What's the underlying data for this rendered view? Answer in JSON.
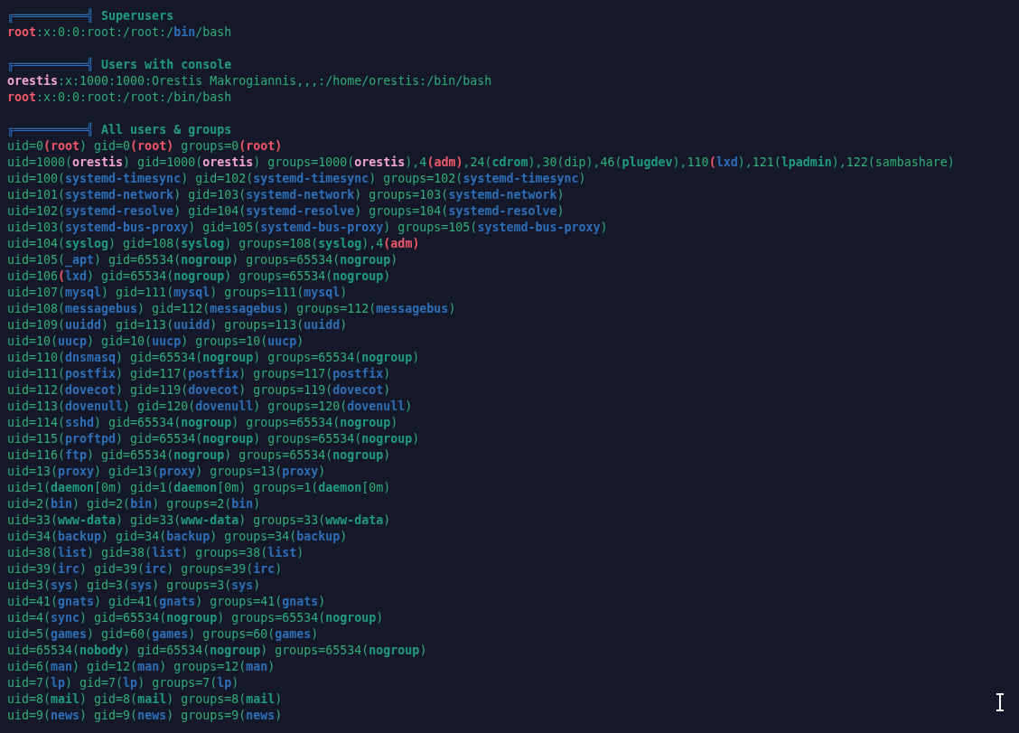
{
  "sections": [
    {
      "rule": "╔══════════╣",
      "title": "Superusers",
      "lines": [
        {
          "segments": [
            {
              "kind": "alert",
              "text": "root"
            },
            {
              "kind": "plain",
              "text": ":x:0:0:root:/root:/"
            },
            {
              "kind": "service",
              "text": "bin"
            },
            {
              "kind": "plain",
              "text": "/bash"
            }
          ]
        }
      ]
    },
    {
      "rule": "╔══════════╣",
      "title": "Users with console",
      "lines": [
        {
          "segments": [
            {
              "kind": "user",
              "text": "orestis"
            },
            {
              "kind": "plain",
              "text": ":x:1000:1000:Orestis Makrogiannis,,,:/home/orestis:/bin/bash"
            }
          ]
        },
        {
          "segments": [
            {
              "kind": "alert",
              "text": "root"
            },
            {
              "kind": "plain",
              "text": ":x:0:0:root:/root:/bin/bash"
            }
          ]
        }
      ]
    },
    {
      "rule": "╔══════════╣",
      "title": "All users & groups",
      "lines": [
        {
          "segments": [
            {
              "kind": "plain",
              "text": "uid=0"
            },
            {
              "kind": "alert",
              "text": "(root"
            },
            {
              "kind": "plain",
              "text": ") gid=0"
            },
            {
              "kind": "alert",
              "text": "(root)"
            },
            {
              "kind": "plain",
              "text": " groups=0"
            },
            {
              "kind": "alert",
              "text": "(root)"
            }
          ]
        },
        {
          "segments": [
            {
              "kind": "plain",
              "text": "uid=1000("
            },
            {
              "kind": "user",
              "text": "orestis"
            },
            {
              "kind": "plain",
              "text": ") gid=1000("
            },
            {
              "kind": "user",
              "text": "orestis"
            },
            {
              "kind": "plain",
              "text": ") groups=1000("
            },
            {
              "kind": "user",
              "text": "orestis"
            },
            {
              "kind": "plain",
              "text": "),4"
            },
            {
              "kind": "alert",
              "text": "(adm)"
            },
            {
              "kind": "plain",
              "text": ",24("
            },
            {
              "kind": "group",
              "text": "cdrom"
            },
            {
              "kind": "plain",
              "text": "),30(dip),46("
            },
            {
              "kind": "group",
              "text": "plugdev"
            },
            {
              "kind": "plain",
              "text": "),110"
            },
            {
              "kind": "alert",
              "text": "("
            },
            {
              "kind": "service",
              "text": "lxd"
            },
            {
              "kind": "plain",
              "text": "),121("
            },
            {
              "kind": "group",
              "text": "lpadmin"
            },
            {
              "kind": "plain",
              "text": "),122(sambashare)"
            }
          ]
        },
        {
          "segments": [
            {
              "kind": "plain",
              "text": "uid=100("
            },
            {
              "kind": "service",
              "text": "systemd-timesync"
            },
            {
              "kind": "plain",
              "text": ") gid=102("
            },
            {
              "kind": "service",
              "text": "systemd-timesync"
            },
            {
              "kind": "plain",
              "text": ") groups=102("
            },
            {
              "kind": "service",
              "text": "systemd-timesync"
            },
            {
              "kind": "plain",
              "text": ")"
            }
          ]
        },
        {
          "segments": [
            {
              "kind": "plain",
              "text": "uid=101("
            },
            {
              "kind": "service",
              "text": "systemd-network"
            },
            {
              "kind": "plain",
              "text": ") gid=103("
            },
            {
              "kind": "service",
              "text": "systemd-network"
            },
            {
              "kind": "plain",
              "text": ") groups=103("
            },
            {
              "kind": "service",
              "text": "systemd-network"
            },
            {
              "kind": "plain",
              "text": ")"
            }
          ]
        },
        {
          "segments": [
            {
              "kind": "plain",
              "text": "uid=102("
            },
            {
              "kind": "service",
              "text": "systemd-resolve"
            },
            {
              "kind": "plain",
              "text": ") gid=104("
            },
            {
              "kind": "service",
              "text": "systemd-resolve"
            },
            {
              "kind": "plain",
              "text": ") groups=104("
            },
            {
              "kind": "service",
              "text": "systemd-resolve"
            },
            {
              "kind": "plain",
              "text": ")"
            }
          ]
        },
        {
          "segments": [
            {
              "kind": "plain",
              "text": "uid=103("
            },
            {
              "kind": "service",
              "text": "systemd-bus-proxy"
            },
            {
              "kind": "plain",
              "text": ") gid=105("
            },
            {
              "kind": "service",
              "text": "systemd-bus-proxy"
            },
            {
              "kind": "plain",
              "text": ") groups=105("
            },
            {
              "kind": "service",
              "text": "systemd-bus-proxy"
            },
            {
              "kind": "plain",
              "text": ")"
            }
          ]
        },
        {
          "segments": [
            {
              "kind": "plain",
              "text": "uid=104("
            },
            {
              "kind": "group",
              "text": "syslog"
            },
            {
              "kind": "plain",
              "text": ") gid=108("
            },
            {
              "kind": "group",
              "text": "syslog"
            },
            {
              "kind": "plain",
              "text": ") groups=108("
            },
            {
              "kind": "group",
              "text": "syslog"
            },
            {
              "kind": "plain",
              "text": "),4"
            },
            {
              "kind": "alert",
              "text": "(adm)"
            }
          ]
        },
        {
          "segments": [
            {
              "kind": "plain",
              "text": "uid=105("
            },
            {
              "kind": "service",
              "text": "_apt"
            },
            {
              "kind": "plain",
              "text": ") gid=65534("
            },
            {
              "kind": "group",
              "text": "nogroup"
            },
            {
              "kind": "plain",
              "text": ") groups=65534("
            },
            {
              "kind": "group",
              "text": "nogroup"
            },
            {
              "kind": "plain",
              "text": ")"
            }
          ]
        },
        {
          "segments": [
            {
              "kind": "plain",
              "text": "uid=106"
            },
            {
              "kind": "alert",
              "text": "("
            },
            {
              "kind": "service",
              "text": "lxd"
            },
            {
              "kind": "plain",
              "text": ") gid=65534("
            },
            {
              "kind": "group",
              "text": "nogroup"
            },
            {
              "kind": "plain",
              "text": ") groups=65534("
            },
            {
              "kind": "group",
              "text": "nogroup"
            },
            {
              "kind": "plain",
              "text": ")"
            }
          ]
        },
        {
          "segments": [
            {
              "kind": "plain",
              "text": "uid=107("
            },
            {
              "kind": "service",
              "text": "mysql"
            },
            {
              "kind": "plain",
              "text": ") gid=111("
            },
            {
              "kind": "service",
              "text": "mysql"
            },
            {
              "kind": "plain",
              "text": ") groups=111("
            },
            {
              "kind": "service",
              "text": "mysql"
            },
            {
              "kind": "plain",
              "text": ")"
            }
          ]
        },
        {
          "segments": [
            {
              "kind": "plain",
              "text": "uid=108("
            },
            {
              "kind": "service",
              "text": "messagebus"
            },
            {
              "kind": "plain",
              "text": ") gid=112("
            },
            {
              "kind": "service",
              "text": "messagebus"
            },
            {
              "kind": "plain",
              "text": ") groups=112("
            },
            {
              "kind": "service",
              "text": "messagebus"
            },
            {
              "kind": "plain",
              "text": ")"
            }
          ]
        },
        {
          "segments": [
            {
              "kind": "plain",
              "text": "uid=109("
            },
            {
              "kind": "service",
              "text": "uuidd"
            },
            {
              "kind": "plain",
              "text": ") gid=113("
            },
            {
              "kind": "service",
              "text": "uuidd"
            },
            {
              "kind": "plain",
              "text": ") groups=113("
            },
            {
              "kind": "service",
              "text": "uuidd"
            },
            {
              "kind": "plain",
              "text": ")"
            }
          ]
        },
        {
          "segments": [
            {
              "kind": "plain",
              "text": "uid=10("
            },
            {
              "kind": "service",
              "text": "uucp"
            },
            {
              "kind": "plain",
              "text": ") gid=10("
            },
            {
              "kind": "service",
              "text": "uucp"
            },
            {
              "kind": "plain",
              "text": ") groups=10("
            },
            {
              "kind": "service",
              "text": "uucp"
            },
            {
              "kind": "plain",
              "text": ")"
            }
          ]
        },
        {
          "segments": [
            {
              "kind": "plain",
              "text": "uid=110("
            },
            {
              "kind": "service",
              "text": "dnsmasq"
            },
            {
              "kind": "plain",
              "text": ") gid=65534("
            },
            {
              "kind": "group",
              "text": "nogroup"
            },
            {
              "kind": "plain",
              "text": ") groups=65534("
            },
            {
              "kind": "group",
              "text": "nogroup"
            },
            {
              "kind": "plain",
              "text": ")"
            }
          ]
        },
        {
          "segments": [
            {
              "kind": "plain",
              "text": "uid=111("
            },
            {
              "kind": "service",
              "text": "postfix"
            },
            {
              "kind": "plain",
              "text": ") gid=117("
            },
            {
              "kind": "service",
              "text": "postfix"
            },
            {
              "kind": "plain",
              "text": ") groups=117("
            },
            {
              "kind": "service",
              "text": "postfix"
            },
            {
              "kind": "plain",
              "text": ")"
            }
          ]
        },
        {
          "segments": [
            {
              "kind": "plain",
              "text": "uid=112("
            },
            {
              "kind": "service",
              "text": "dovecot"
            },
            {
              "kind": "plain",
              "text": ") gid=119("
            },
            {
              "kind": "service",
              "text": "dovecot"
            },
            {
              "kind": "plain",
              "text": ") groups=119("
            },
            {
              "kind": "service",
              "text": "dovecot"
            },
            {
              "kind": "plain",
              "text": ")"
            }
          ]
        },
        {
          "segments": [
            {
              "kind": "plain",
              "text": "uid=113("
            },
            {
              "kind": "service",
              "text": "dovenull"
            },
            {
              "kind": "plain",
              "text": ") gid=120("
            },
            {
              "kind": "service",
              "text": "dovenull"
            },
            {
              "kind": "plain",
              "text": ") groups=120("
            },
            {
              "kind": "service",
              "text": "dovenull"
            },
            {
              "kind": "plain",
              "text": ")"
            }
          ]
        },
        {
          "segments": [
            {
              "kind": "plain",
              "text": "uid=114("
            },
            {
              "kind": "service",
              "text": "sshd"
            },
            {
              "kind": "plain",
              "text": ") gid=65534("
            },
            {
              "kind": "group",
              "text": "nogroup"
            },
            {
              "kind": "plain",
              "text": ") groups=65534("
            },
            {
              "kind": "group",
              "text": "nogroup"
            },
            {
              "kind": "plain",
              "text": ")"
            }
          ]
        },
        {
          "segments": [
            {
              "kind": "plain",
              "text": "uid=115("
            },
            {
              "kind": "service",
              "text": "proftpd"
            },
            {
              "kind": "plain",
              "text": ") gid=65534("
            },
            {
              "kind": "group",
              "text": "nogroup"
            },
            {
              "kind": "plain",
              "text": ") groups=65534("
            },
            {
              "kind": "group",
              "text": "nogroup"
            },
            {
              "kind": "plain",
              "text": ")"
            }
          ]
        },
        {
          "segments": [
            {
              "kind": "plain",
              "text": "uid=116("
            },
            {
              "kind": "service",
              "text": "ftp"
            },
            {
              "kind": "plain",
              "text": ") gid=65534("
            },
            {
              "kind": "group",
              "text": "nogroup"
            },
            {
              "kind": "plain",
              "text": ") groups=65534("
            },
            {
              "kind": "group",
              "text": "nogroup"
            },
            {
              "kind": "plain",
              "text": ")"
            }
          ]
        },
        {
          "segments": [
            {
              "kind": "plain",
              "text": "uid=13("
            },
            {
              "kind": "service",
              "text": "proxy"
            },
            {
              "kind": "plain",
              "text": ") gid=13("
            },
            {
              "kind": "service",
              "text": "proxy"
            },
            {
              "kind": "plain",
              "text": ") groups=13("
            },
            {
              "kind": "service",
              "text": "proxy"
            },
            {
              "kind": "plain",
              "text": ")"
            }
          ]
        },
        {
          "segments": [
            {
              "kind": "plain",
              "text": "uid=1("
            },
            {
              "kind": "group",
              "text": "daemon"
            },
            {
              "kind": "plain",
              "text": "[0m) gid=1("
            },
            {
              "kind": "group",
              "text": "daemon"
            },
            {
              "kind": "plain",
              "text": "[0m) groups=1("
            },
            {
              "kind": "group",
              "text": "daemon"
            },
            {
              "kind": "plain",
              "text": "[0m)"
            }
          ]
        },
        {
          "segments": [
            {
              "kind": "plain",
              "text": "uid=2("
            },
            {
              "kind": "service",
              "text": "bin"
            },
            {
              "kind": "plain",
              "text": ") gid=2("
            },
            {
              "kind": "service",
              "text": "bin"
            },
            {
              "kind": "plain",
              "text": ") groups=2("
            },
            {
              "kind": "service",
              "text": "bin"
            },
            {
              "kind": "plain",
              "text": ")"
            }
          ]
        },
        {
          "segments": [
            {
              "kind": "plain",
              "text": "uid=33("
            },
            {
              "kind": "group",
              "text": "www-data"
            },
            {
              "kind": "plain",
              "text": ") gid=33("
            },
            {
              "kind": "group",
              "text": "www-data"
            },
            {
              "kind": "plain",
              "text": ") groups=33("
            },
            {
              "kind": "group",
              "text": "www-data"
            },
            {
              "kind": "plain",
              "text": ")"
            }
          ]
        },
        {
          "segments": [
            {
              "kind": "plain",
              "text": "uid=34("
            },
            {
              "kind": "service",
              "text": "backup"
            },
            {
              "kind": "plain",
              "text": ") gid=34("
            },
            {
              "kind": "service",
              "text": "backup"
            },
            {
              "kind": "plain",
              "text": ") groups=34("
            },
            {
              "kind": "service",
              "text": "backup"
            },
            {
              "kind": "plain",
              "text": ")"
            }
          ]
        },
        {
          "segments": [
            {
              "kind": "plain",
              "text": "uid=38("
            },
            {
              "kind": "service",
              "text": "list"
            },
            {
              "kind": "plain",
              "text": ") gid=38("
            },
            {
              "kind": "service",
              "text": "list"
            },
            {
              "kind": "plain",
              "text": ") groups=38("
            },
            {
              "kind": "service",
              "text": "list"
            },
            {
              "kind": "plain",
              "text": ")"
            }
          ]
        },
        {
          "segments": [
            {
              "kind": "plain",
              "text": "uid=39("
            },
            {
              "kind": "service",
              "text": "irc"
            },
            {
              "kind": "plain",
              "text": ") gid=39("
            },
            {
              "kind": "service",
              "text": "irc"
            },
            {
              "kind": "plain",
              "text": ") groups=39("
            },
            {
              "kind": "service",
              "text": "irc"
            },
            {
              "kind": "plain",
              "text": ")"
            }
          ]
        },
        {
          "segments": [
            {
              "kind": "plain",
              "text": "uid=3("
            },
            {
              "kind": "service",
              "text": "sys"
            },
            {
              "kind": "plain",
              "text": ") gid=3("
            },
            {
              "kind": "service",
              "text": "sys"
            },
            {
              "kind": "plain",
              "text": ") groups=3("
            },
            {
              "kind": "service",
              "text": "sys"
            },
            {
              "kind": "plain",
              "text": ")"
            }
          ]
        },
        {
          "segments": [
            {
              "kind": "plain",
              "text": "uid=41("
            },
            {
              "kind": "service",
              "text": "gnats"
            },
            {
              "kind": "plain",
              "text": ") gid=41("
            },
            {
              "kind": "service",
              "text": "gnats"
            },
            {
              "kind": "plain",
              "text": ") groups=41("
            },
            {
              "kind": "service",
              "text": "gnats"
            },
            {
              "kind": "plain",
              "text": ")"
            }
          ]
        },
        {
          "segments": [
            {
              "kind": "plain",
              "text": "uid=4("
            },
            {
              "kind": "service",
              "text": "sync"
            },
            {
              "kind": "plain",
              "text": ") gid=65534("
            },
            {
              "kind": "group",
              "text": "nogroup"
            },
            {
              "kind": "plain",
              "text": ") groups=65534("
            },
            {
              "kind": "group",
              "text": "nogroup"
            },
            {
              "kind": "plain",
              "text": ")"
            }
          ]
        },
        {
          "segments": [
            {
              "kind": "plain",
              "text": "uid=5("
            },
            {
              "kind": "service",
              "text": "games"
            },
            {
              "kind": "plain",
              "text": ") gid=60("
            },
            {
              "kind": "service",
              "text": "games"
            },
            {
              "kind": "plain",
              "text": ") groups=60("
            },
            {
              "kind": "service",
              "text": "games"
            },
            {
              "kind": "plain",
              "text": ")"
            }
          ]
        },
        {
          "segments": [
            {
              "kind": "plain",
              "text": "uid=65534("
            },
            {
              "kind": "group",
              "text": "nobody"
            },
            {
              "kind": "plain",
              "text": ") gid=65534("
            },
            {
              "kind": "group",
              "text": "nogroup"
            },
            {
              "kind": "plain",
              "text": ") groups=65534("
            },
            {
              "kind": "group",
              "text": "nogroup"
            },
            {
              "kind": "plain",
              "text": ")"
            }
          ]
        },
        {
          "segments": [
            {
              "kind": "plain",
              "text": "uid=6("
            },
            {
              "kind": "service",
              "text": "man"
            },
            {
              "kind": "plain",
              "text": ") gid=12("
            },
            {
              "kind": "service",
              "text": "man"
            },
            {
              "kind": "plain",
              "text": ") groups=12("
            },
            {
              "kind": "service",
              "text": "man"
            },
            {
              "kind": "plain",
              "text": ")"
            }
          ]
        },
        {
          "segments": [
            {
              "kind": "plain",
              "text": "uid=7("
            },
            {
              "kind": "service",
              "text": "lp"
            },
            {
              "kind": "plain",
              "text": ") gid=7("
            },
            {
              "kind": "service",
              "text": "lp"
            },
            {
              "kind": "plain",
              "text": ") groups=7("
            },
            {
              "kind": "service",
              "text": "lp"
            },
            {
              "kind": "plain",
              "text": ")"
            }
          ]
        },
        {
          "segments": [
            {
              "kind": "plain",
              "text": "uid=8("
            },
            {
              "kind": "group",
              "text": "mail"
            },
            {
              "kind": "plain",
              "text": ") gid=8("
            },
            {
              "kind": "group",
              "text": "mail"
            },
            {
              "kind": "plain",
              "text": ") groups=8("
            },
            {
              "kind": "group",
              "text": "mail"
            },
            {
              "kind": "plain",
              "text": ")"
            }
          ]
        },
        {
          "segments": [
            {
              "kind": "plain",
              "text": "uid=9("
            },
            {
              "kind": "service",
              "text": "news"
            },
            {
              "kind": "plain",
              "text": ") gid=9("
            },
            {
              "kind": "service",
              "text": "news"
            },
            {
              "kind": "plain",
              "text": ") groups=9("
            },
            {
              "kind": "service",
              "text": "news"
            },
            {
              "kind": "plain",
              "text": ")"
            }
          ]
        }
      ]
    }
  ]
}
